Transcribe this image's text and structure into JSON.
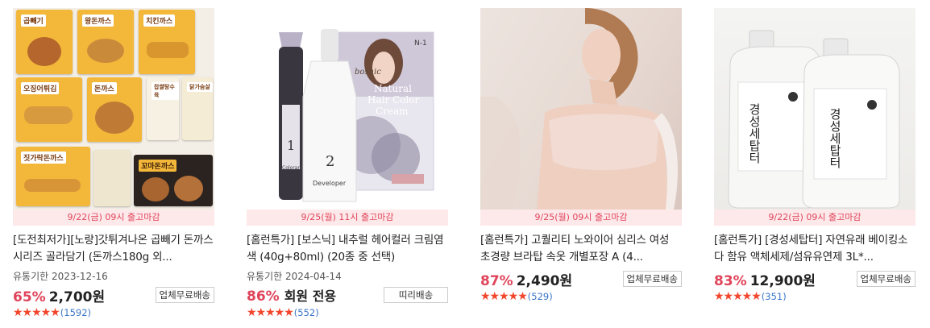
{
  "products": [
    {
      "deadline": "9/22(금) 09시 출고마감",
      "title": "[도전최저가][노랑]갓튀겨나온 곱빼기 돈까스 시리즈 골라담기 (돈까스180g 외...",
      "expiry": "유통기한 2023-12-16",
      "discount": "65%",
      "price": "2,700원",
      "shipping": "업체무료배송",
      "reviews": "(1592)",
      "pack_labels": [
        "곱빼기",
        "왕돈까스",
        "치킨까스",
        "오징어튀김",
        "돈까스",
        "찹쌀탕수육",
        "닭가슴살",
        "짓가락돈까스",
        "꼬마돈까스"
      ]
    },
    {
      "deadline": "9/25(월) 11시 출고마감",
      "title": "[홈런특가] [보스닉] 내추럴 헤어컬러 크림염색 (40g+80ml) (20종 중 선택)",
      "expiry": "유통기한 2024-04-14",
      "discount": "86%",
      "member": "회원 전용",
      "shipping": "띠리배송",
      "reviews": "(552)",
      "box_text": [
        "bosnic",
        "Natural",
        "Hair Color",
        "Cream",
        "1",
        "Colorant",
        "2",
        "Developer",
        "N-1"
      ]
    },
    {
      "deadline": "9/25(월) 09시 출고마감",
      "title": "[홈런특가] 고퀄리티 노와이어 심리스 여성 초경량 브라탑 속옷 개별포장 A (4...",
      "discount": "87%",
      "price": "2,490원",
      "shipping": "업체무료배송",
      "reviews": "(529)"
    },
    {
      "deadline": "9/22(금) 09시 출고마감",
      "title": "[홈런특가] [경성세탑터] 자연유래 베이킹소다 함유 액체세제/섬유유연제 3L*...",
      "discount": "83%",
      "price": "12,900원",
      "shipping": "업체무료배송",
      "reviews": "(351)",
      "bottle_text": "경성세탑터"
    }
  ],
  "stars": "★★★★★",
  "colors": {
    "accent": "#e0445a",
    "deadline_bg": "#fde9ea",
    "review_link": "#3a76c8"
  }
}
